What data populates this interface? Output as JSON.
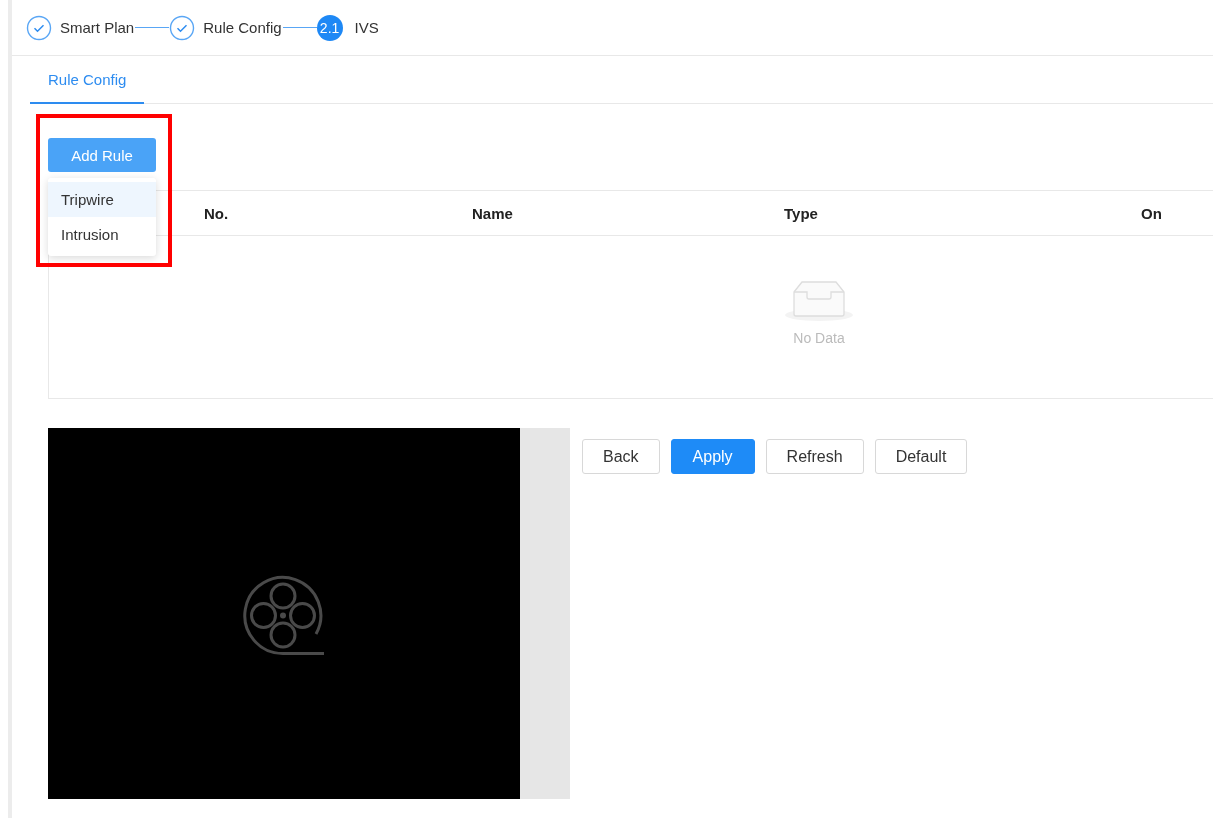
{
  "steps": [
    {
      "label": "Smart Plan",
      "kind": "done"
    },
    {
      "label": "Rule Config",
      "kind": "done"
    },
    {
      "label": "IVS",
      "kind": "current",
      "number": "2.1"
    }
  ],
  "tabs": [
    {
      "label": "Rule Config",
      "selected": true
    }
  ],
  "add_rule": {
    "label": "Add Rule",
    "expanded": true,
    "options": [
      {
        "label": "Tripwire",
        "highlighted": true
      },
      {
        "label": "Intrusion",
        "highlighted": false
      }
    ]
  },
  "annotation": {
    "kind": "highlight-frame"
  },
  "table": {
    "columns": [
      "No.",
      "Name",
      "Type",
      "On"
    ],
    "empty_text": "No Data"
  },
  "buttons": [
    {
      "label": "Back",
      "kind": "default"
    },
    {
      "label": "Apply",
      "kind": "primary"
    },
    {
      "label": "Refresh",
      "kind": "default"
    },
    {
      "label": "Default",
      "kind": "default"
    }
  ]
}
